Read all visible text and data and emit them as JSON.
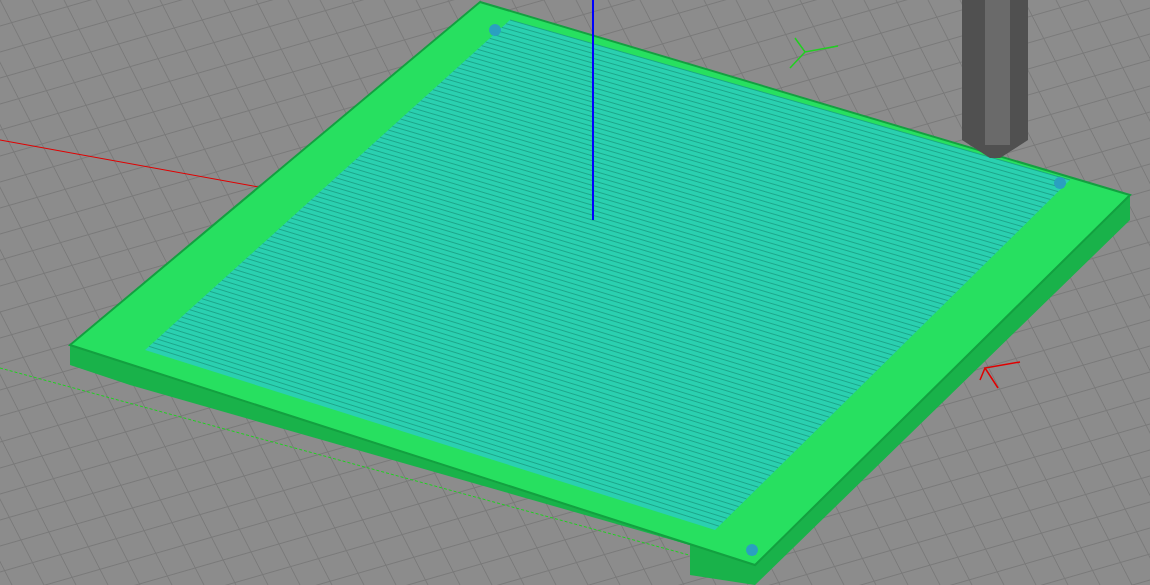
{
  "viewport": {
    "kind": "print-preview"
  }
}
